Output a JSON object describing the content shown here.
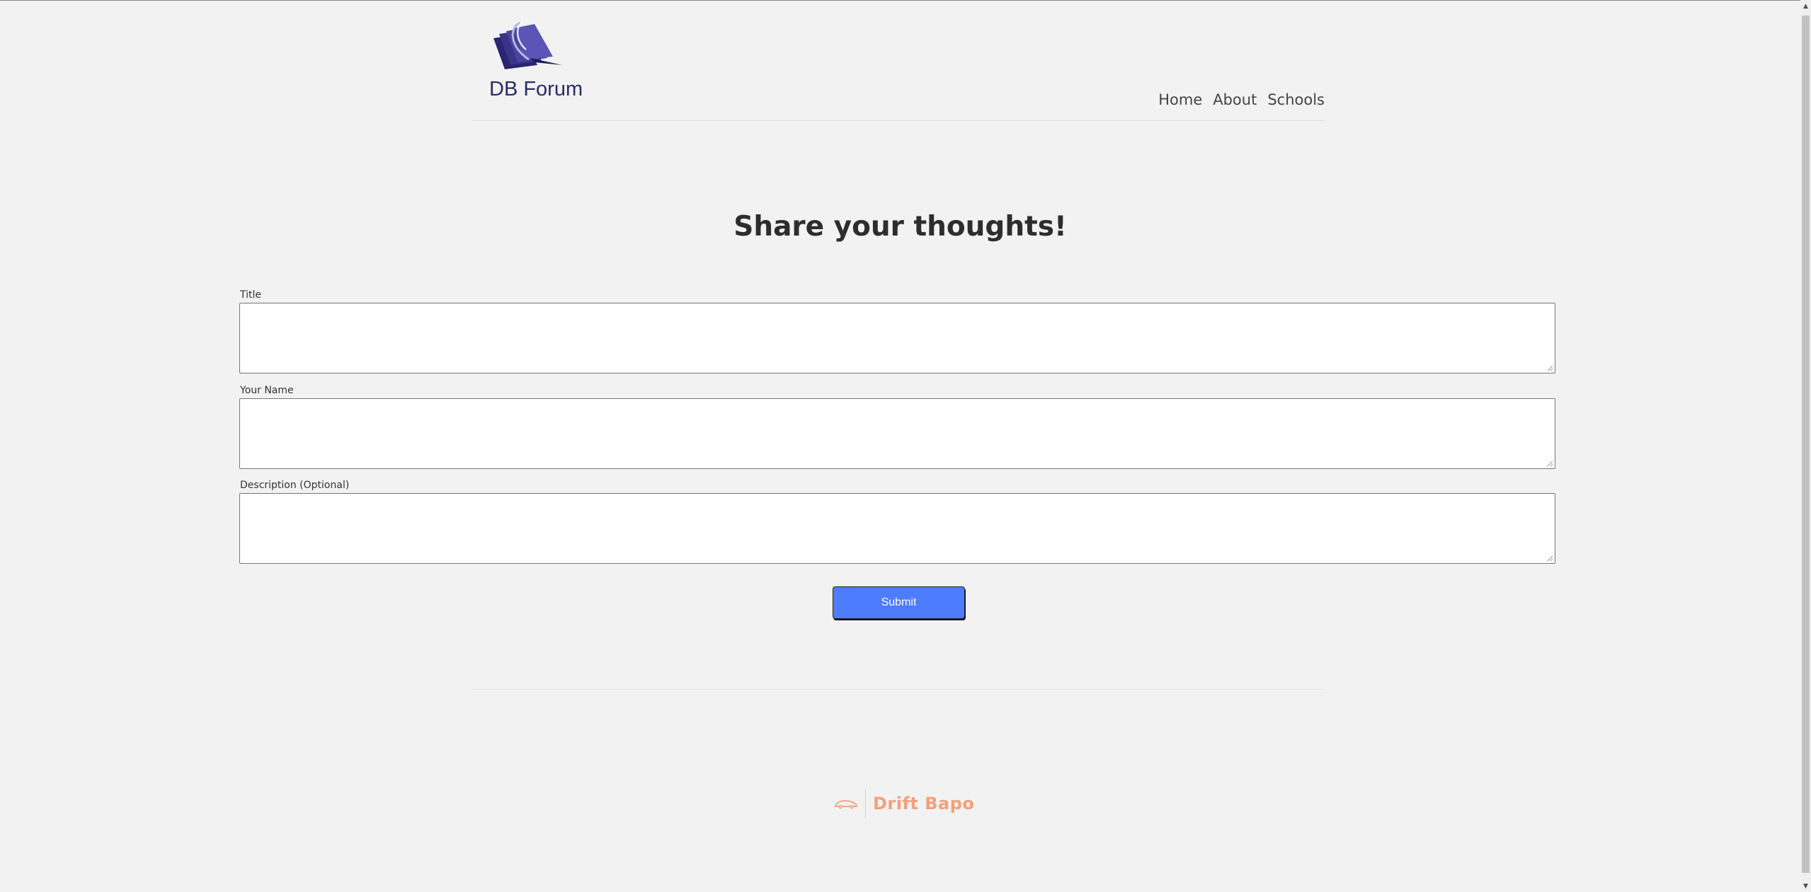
{
  "header": {
    "logo_text": "DB Forum",
    "nav": [
      "Home",
      "About",
      "Schools"
    ]
  },
  "main": {
    "heading": "Share your thoughts!",
    "fields": [
      {
        "label": "Title",
        "value": ""
      },
      {
        "label": "Your Name",
        "value": ""
      },
      {
        "label": "Description (Optional)",
        "value": ""
      }
    ],
    "submit_label": "Submit"
  },
  "footer": {
    "brand_text": "Drift Bapo",
    "brand_icon": "car-icon"
  },
  "colors": {
    "background": "#f2f2f2",
    "accent": "#4d7cfe",
    "brand": "#f3a07a",
    "logo": "#2b2a6a"
  }
}
